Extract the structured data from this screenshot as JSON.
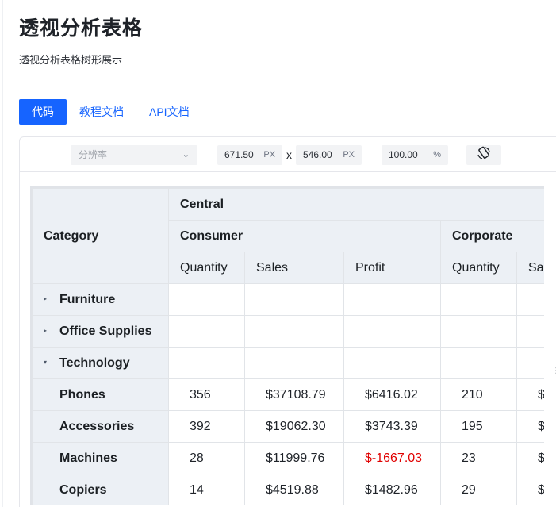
{
  "page": {
    "title": "透视分析表格",
    "subtitle": "透视分析表格树形展示"
  },
  "tabs": [
    {
      "label": "代码",
      "active": true
    },
    {
      "label": "教程文档",
      "active": false
    },
    {
      "label": "API文档",
      "active": false
    }
  ],
  "toolbar": {
    "resolution_placeholder": "分辨率",
    "width_value": "671.50",
    "width_unit": "PX",
    "times": "x",
    "height_value": "546.00",
    "height_unit": "PX",
    "zoom_value": "100.00",
    "zoom_unit": "%",
    "rotate_icon": "rotate-device-icon"
  },
  "pivot": {
    "corner_label": "Category",
    "region": "Central",
    "segments": [
      "Consumer",
      "Corporate"
    ],
    "measures": [
      "Quantity",
      "Sales",
      "Profit",
      "Quantity",
      "Sa"
    ],
    "rows": [
      {
        "label": "Furniture",
        "expander": "▸",
        "values": [
          "",
          "",
          "",
          "",
          ""
        ]
      },
      {
        "label": "Office Supplies",
        "expander": "▸",
        "values": [
          "",
          "",
          "",
          "",
          ""
        ]
      },
      {
        "label": "Technology",
        "expander": "▾",
        "values": [
          "",
          "",
          "",
          "",
          ""
        ]
      },
      {
        "label": "Phones",
        "values": [
          "356",
          "$37108.79",
          "$6416.02",
          "210",
          "$"
        ]
      },
      {
        "label": "Accessories",
        "values": [
          "392",
          "$19062.30",
          "$3743.39",
          "195",
          "$"
        ]
      },
      {
        "label": "Machines",
        "values": [
          "28",
          "$11999.76",
          "$-1667.03",
          "23",
          "$"
        ]
      },
      {
        "label": "Copiers",
        "values": [
          "14",
          "$4519.88",
          "$1482.96",
          "29",
          "$"
        ]
      }
    ],
    "negative_color": "#e00000"
  },
  "colors": {
    "accent": "#1664ff",
    "header_bg": "#ecf0f5"
  }
}
